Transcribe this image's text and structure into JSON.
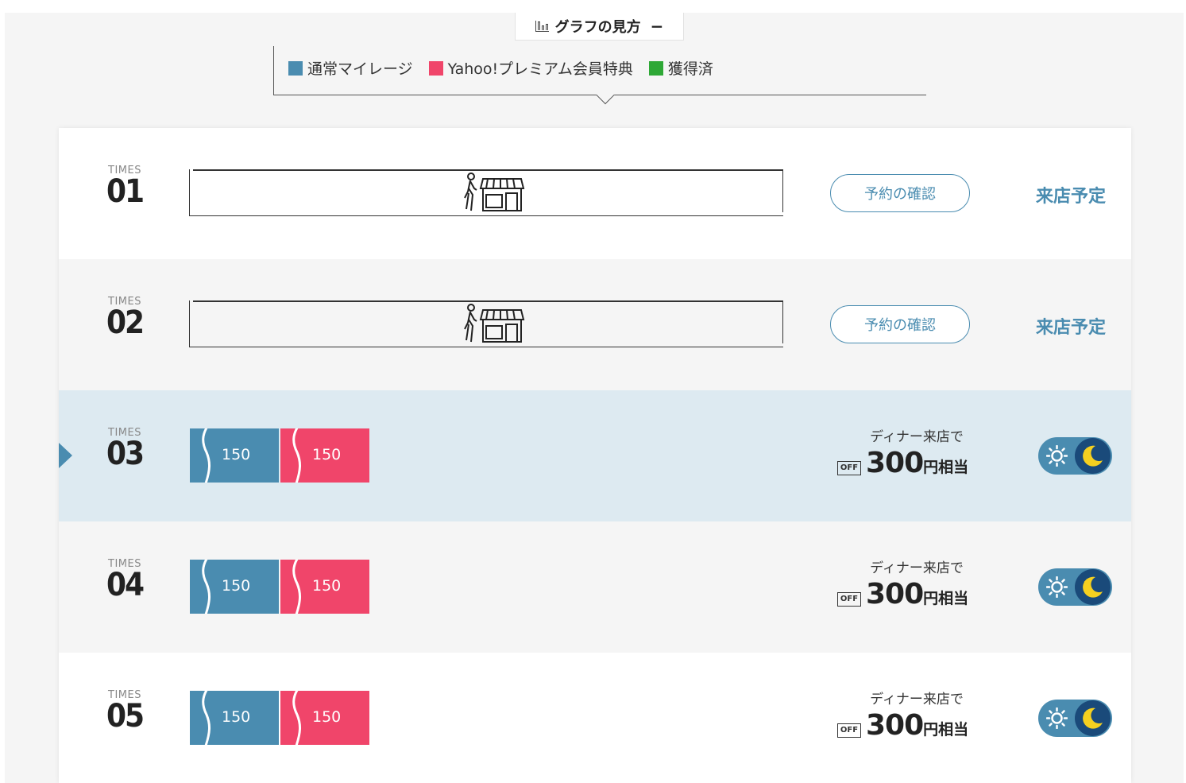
{
  "guide": {
    "title": "グラフの見方",
    "collapse": "−"
  },
  "legend": [
    {
      "label": "通常マイレージ",
      "color": "#4a8cb0"
    },
    {
      "label": "Yahoo!プレミアム会員特典",
      "color": "#f0456a"
    },
    {
      "label": "獲得済",
      "color": "#2ea836"
    }
  ],
  "rows": [
    {
      "times_label": "TIMES",
      "number": "01",
      "type": "scheduled",
      "button": "予約の確認",
      "status": "来店予定"
    },
    {
      "times_label": "TIMES",
      "number": "02",
      "type": "scheduled",
      "button": "予約の確認",
      "status": "来店予定"
    },
    {
      "times_label": "TIMES",
      "number": "03",
      "type": "mileage",
      "current": true,
      "regular": "150",
      "premium": "150",
      "desc": "ディナー来店で",
      "off": "OFF",
      "amount": "300",
      "unit": "円相当",
      "mode": "night"
    },
    {
      "times_label": "TIMES",
      "number": "04",
      "type": "mileage",
      "regular": "150",
      "premium": "150",
      "desc": "ディナー来店で",
      "off": "OFF",
      "amount": "300",
      "unit": "円相当",
      "mode": "night"
    },
    {
      "times_label": "TIMES",
      "number": "05",
      "type": "mileage",
      "regular": "150",
      "premium": "150",
      "desc": "ディナー来店で",
      "off": "OFF",
      "amount": "300",
      "unit": "円相当",
      "mode": "night"
    }
  ]
}
